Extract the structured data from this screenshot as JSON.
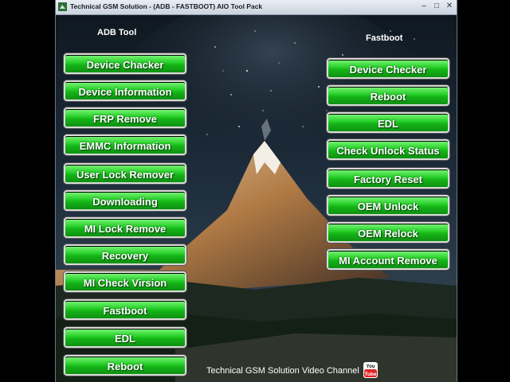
{
  "window": {
    "title": "Technical GSM Solution - (ADB - FASTBOOT) AIO Tool Pack",
    "controls": {
      "minimize": "–",
      "maximize": "□",
      "close": "✕"
    }
  },
  "adb": {
    "heading": "ADB Tool",
    "buttons": [
      "Device Chacker",
      "Device Information",
      "FRP Remove",
      "EMMC Information",
      "User Lock Remover",
      "Downloading",
      "MI Lock Remove",
      "Recovery",
      "MI Check Virsion",
      "Fastboot",
      "EDL",
      "Reboot"
    ]
  },
  "fastboot": {
    "heading": "Fastboot",
    "buttons": [
      "Device Checker",
      "Reboot",
      "EDL",
      "Check Unlock Status",
      "Factory Reset",
      "OEM Unlock",
      "OEM Relock",
      "MI Account Remove"
    ]
  },
  "footer": {
    "channel": "Technical GSM Solution Video Channel",
    "youtube_label": "You Tube"
  },
  "colors": {
    "button_green": "#14b417",
    "background": "#1b2430"
  }
}
